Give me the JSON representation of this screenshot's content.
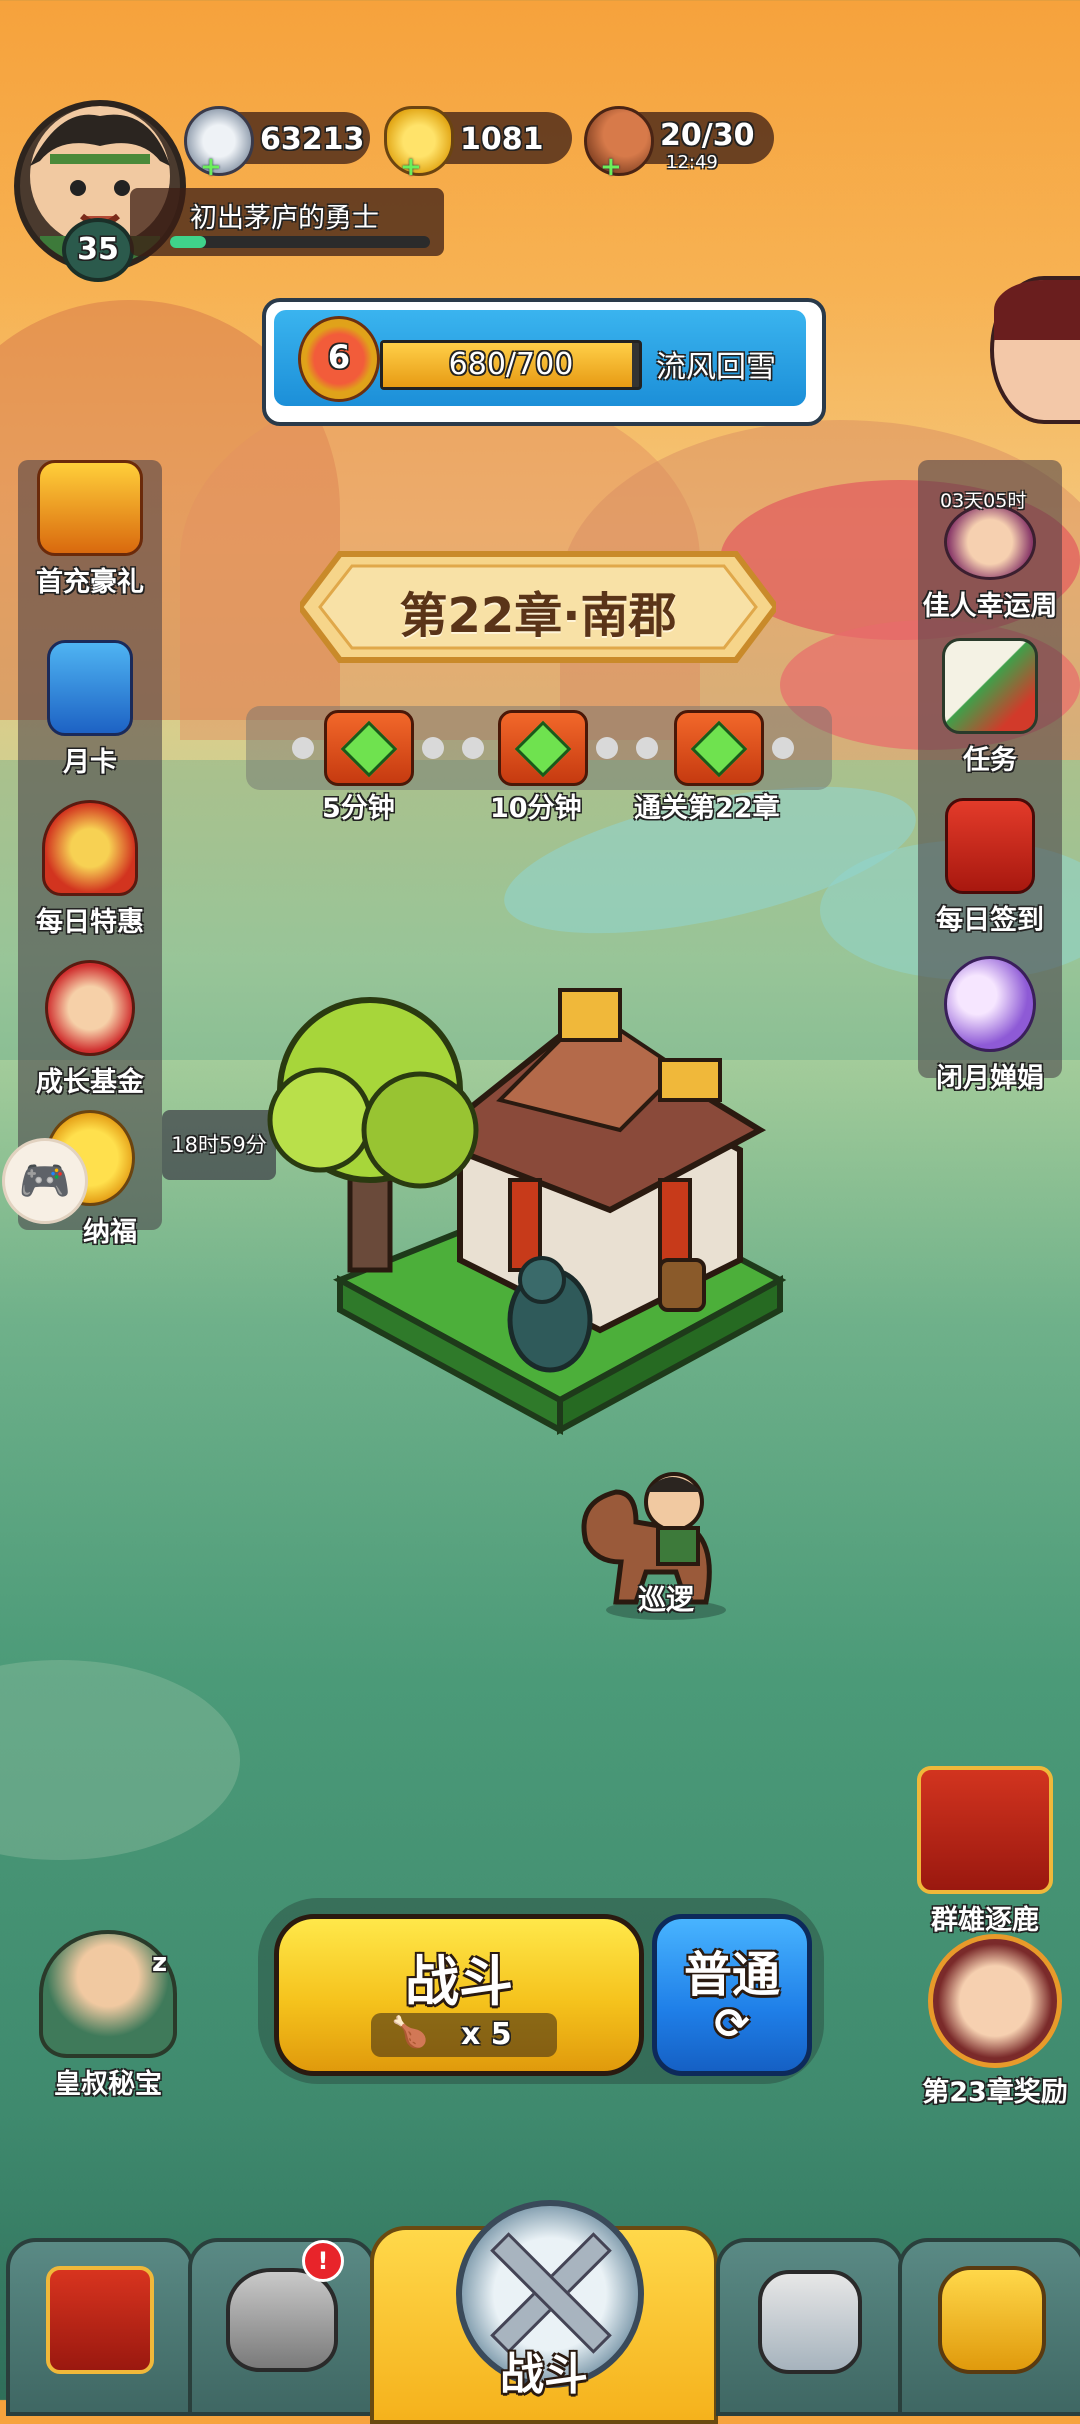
{
  "player": {
    "level": "35",
    "title": "初出茅庐的勇士"
  },
  "resources": {
    "silver": "63213",
    "gold": "1081",
    "stamina": "20/30",
    "stamina_timer": "12:49"
  },
  "stage_progress": {
    "rank": "6",
    "progress_text": "680/700",
    "progress_fraction": 0.971,
    "stage_name": "流风回雪"
  },
  "chapter": {
    "title": "第22章·南郡"
  },
  "chest_rewards": [
    {
      "label": "5分钟"
    },
    {
      "label": "10分钟"
    },
    {
      "label": "通关第22章"
    }
  ],
  "left_menu": [
    {
      "label": "首充豪礼",
      "icon": "treasure-chest-icon"
    },
    {
      "label": "月卡",
      "icon": "month-card-icon"
    },
    {
      "label": "每日特惠",
      "icon": "gift-bag-icon"
    },
    {
      "label": "成长基金",
      "icon": "fund-icon"
    },
    {
      "label": "纳福",
      "icon": "duck-icon",
      "timer": "18时59分"
    }
  ],
  "right_menu": [
    {
      "label": "佳人幸运周",
      "icon": "beauty-avatar-icon",
      "timer": "03天05时"
    },
    {
      "label": "任务",
      "icon": "scroll-icon"
    },
    {
      "label": "每日签到",
      "icon": "sign-in-icon"
    },
    {
      "label": "闭月婵娟",
      "icon": "moon-icon"
    }
  ],
  "scene": {
    "hero_label": "巡逻"
  },
  "events": {
    "qunxiong": "群雄逐鹿",
    "chapter_reward": "第23章奖励",
    "uncle_treasure": "皇叔秘宝",
    "sleep_z": "z"
  },
  "battle": {
    "label": "战斗",
    "cost": "x 5",
    "mode": "普通",
    "mode_refresh_icon": "⟳"
  },
  "bottom_nav": [
    {
      "name": "nav-city",
      "icon": "gate-icon"
    },
    {
      "name": "nav-hero",
      "icon": "helmet-icon",
      "badge": "!"
    },
    {
      "name": "nav-battle",
      "icon": "crossed-swords-icon",
      "label": "战斗"
    },
    {
      "name": "nav-rank",
      "icon": "stars-icon"
    },
    {
      "name": "nav-upgrade",
      "icon": "fist-up-icon"
    }
  ],
  "colors": {
    "accent": "#f5c21c",
    "mode_blue": "#1f7fe8",
    "banner": "#f6d58a"
  }
}
